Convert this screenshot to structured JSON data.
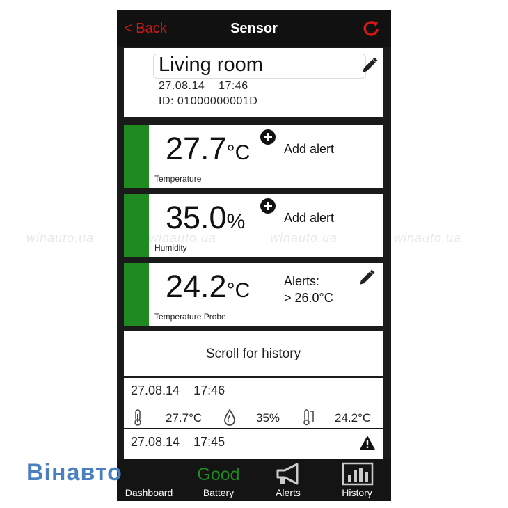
{
  "navbar": {
    "back_label": "< Back",
    "title": "Sensor"
  },
  "sensor": {
    "name": "Living room",
    "date": "27.08.14",
    "time": "17:46",
    "id": "ID: 01000000001D"
  },
  "readings": [
    {
      "value": "27.7",
      "unit": "°C",
      "label": "Temperature",
      "action": "Add alert"
    },
    {
      "value": "35.0",
      "unit": "%",
      "label": "Humidity",
      "action": "Add alert"
    },
    {
      "value": "24.2",
      "unit": "°C",
      "label": "Temperature Probe",
      "alerts_title": "Alerts:",
      "alerts_value": "> 26.0°C"
    }
  ],
  "scroll_hint": "Scroll for history",
  "history": [
    {
      "date": "27.08.14",
      "time": "17:46",
      "temperature": "27.7°C",
      "humidity": "35%",
      "probe": "24.2°C"
    },
    {
      "date": "27.08.14",
      "time": "17:45"
    }
  ],
  "tabs": {
    "dashboard": "Dashboard",
    "battery": "Battery",
    "battery_status": "Good",
    "alerts": "Alerts",
    "history": "History"
  },
  "watermark": "winauto.ua",
  "logo": "Вінавто",
  "colors": {
    "accent_red": "#d01818",
    "status_green": "#1f8a1f",
    "background_dark": "#1a1a1a"
  }
}
